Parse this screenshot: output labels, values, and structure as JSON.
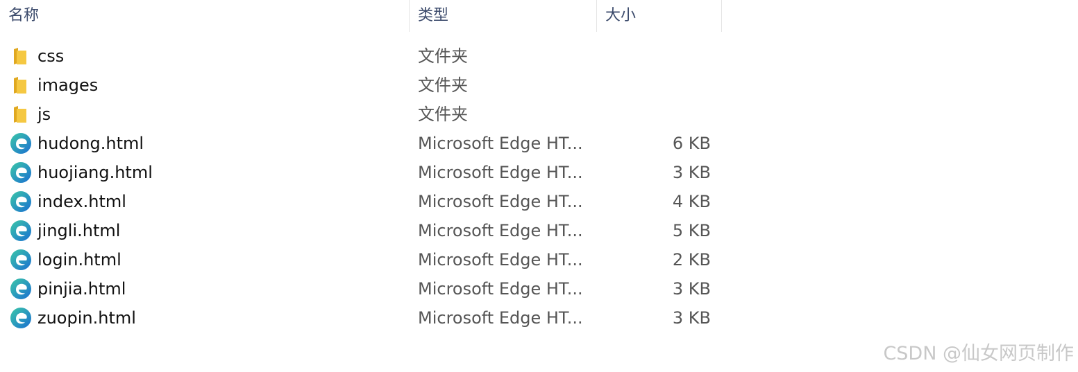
{
  "columns": {
    "name": "名称",
    "type": "类型",
    "size": "大小"
  },
  "sort_indicator": "^",
  "files": [
    {
      "name": "css",
      "type": "文件夹",
      "size": "",
      "icon": "folder-icon"
    },
    {
      "name": "images",
      "type": "文件夹",
      "size": "",
      "icon": "folder-icon"
    },
    {
      "name": "js",
      "type": "文件夹",
      "size": "",
      "icon": "folder-icon"
    },
    {
      "name": "hudong.html",
      "type": "Microsoft Edge HT...",
      "size": "6 KB",
      "icon": "edge-icon"
    },
    {
      "name": "huojiang.html",
      "type": "Microsoft Edge HT...",
      "size": "3 KB",
      "icon": "edge-icon"
    },
    {
      "name": "index.html",
      "type": "Microsoft Edge HT...",
      "size": "4 KB",
      "icon": "edge-icon"
    },
    {
      "name": "jingli.html",
      "type": "Microsoft Edge HT...",
      "size": "5 KB",
      "icon": "edge-icon"
    },
    {
      "name": "login.html",
      "type": "Microsoft Edge HT...",
      "size": "2 KB",
      "icon": "edge-icon"
    },
    {
      "name": "pinjia.html",
      "type": "Microsoft Edge HT...",
      "size": "3 KB",
      "icon": "edge-icon"
    },
    {
      "name": "zuopin.html",
      "type": "Microsoft Edge HT...",
      "size": "3 KB",
      "icon": "edge-icon"
    }
  ],
  "watermark": "CSDN @仙女网页制作",
  "colors": {
    "folder": "#f5c842",
    "folder_dark": "#e0a820",
    "edge_blue": "#1a6fd1",
    "edge_teal": "#3cc8a8",
    "header_text": "#3b4a6b",
    "secondary_text": "#555555"
  }
}
